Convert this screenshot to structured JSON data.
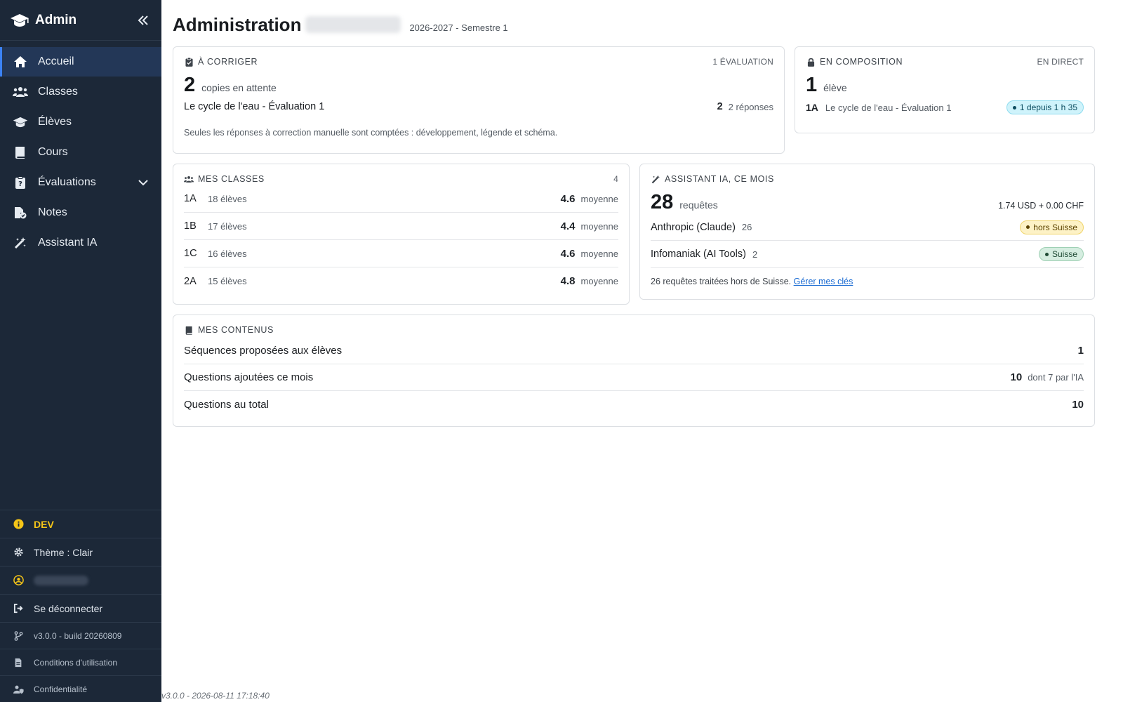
{
  "sidebar": {
    "brand": "Admin",
    "items": [
      {
        "label": "Accueil"
      },
      {
        "label": "Classes"
      },
      {
        "label": "Élèves"
      },
      {
        "label": "Cours"
      },
      {
        "label": "Évaluations"
      },
      {
        "label": "Notes"
      },
      {
        "label": "Assistant IA"
      }
    ],
    "footer": {
      "env": "DEV",
      "theme": "Thème : Clair",
      "logout": "Se déconnecter",
      "version": "v3.0.0 - build 20260809",
      "terms": "Conditions d'utilisation",
      "privacy": "Confidentialité"
    }
  },
  "header": {
    "title": "Administration",
    "period": "2026-2027 - Semestre 1"
  },
  "to_correct": {
    "title": "À CORRIGER",
    "right": "1 ÉVALUATION",
    "count": "2",
    "unit": "copies en attente",
    "eval_name": "Le cycle de l'eau - Évaluation 1",
    "eval_count": "2",
    "eval_unit": "2 réponses",
    "note": "Seules les réponses à correction manuelle sont comptées : développement, légende et schéma."
  },
  "composition": {
    "title": "EN COMPOSITION",
    "right": "EN DIRECT",
    "count": "1",
    "unit": "élève",
    "class": "1A",
    "eval_name": "Le cycle de l'eau - Évaluation 1",
    "badge": "1 depuis 1 h 35"
  },
  "classes": {
    "title": "MES CLASSES",
    "right": "4",
    "rows": [
      {
        "code": "1A",
        "students": "18 élèves",
        "avg": "4.6",
        "avg_label": "moyenne"
      },
      {
        "code": "1B",
        "students": "17 élèves",
        "avg": "4.4",
        "avg_label": "moyenne"
      },
      {
        "code": "1C",
        "students": "16 élèves",
        "avg": "4.6",
        "avg_label": "moyenne"
      },
      {
        "code": "2A",
        "students": "15 élèves",
        "avg": "4.8",
        "avg_label": "moyenne"
      }
    ]
  },
  "assistant": {
    "title": "ASSISTANT IA, CE MOIS",
    "count": "28",
    "unit": "requêtes",
    "cost": "1.74 USD + 0.00 CHF",
    "providers": [
      {
        "name": "Anthropic (Claude)",
        "count": "26",
        "badge": "hors Suisse"
      },
      {
        "name": "Infomaniak (AI Tools)",
        "count": "2",
        "badge": "Suisse"
      }
    ],
    "note": "26 requêtes traitées hors de Suisse.",
    "link": "Gérer mes clés"
  },
  "contents": {
    "title": "MES CONTENUS",
    "rows": [
      {
        "label": "Séquences proposées aux élèves",
        "value": "1",
        "note": ""
      },
      {
        "label": "Questions ajoutées ce mois",
        "value": "10",
        "note": "dont 7 par l'IA"
      },
      {
        "label": "Questions au total",
        "value": "10",
        "note": ""
      }
    ]
  },
  "footer_version": "v3.0.0 - 2026-08-11 17:18:40"
}
